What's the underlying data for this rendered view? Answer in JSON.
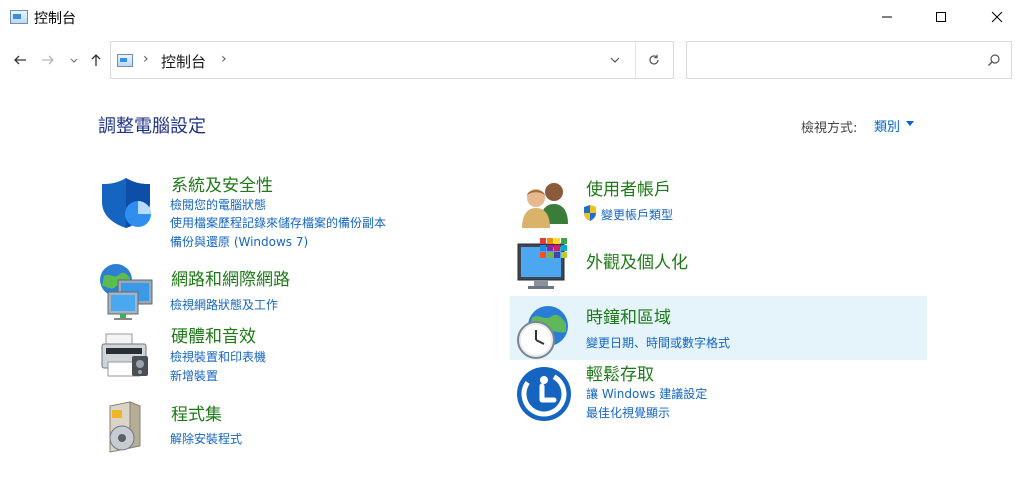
{
  "window": {
    "title": "控制台"
  },
  "address_bar": {
    "path": "控制台",
    "search_placeholder": ""
  },
  "page": {
    "title": "調整電腦設定",
    "view_by_label": "檢視方式:",
    "view_by_value": "類別"
  },
  "categories": {
    "system_security": {
      "title": "系統及安全性",
      "links": [
        "檢閱您的電腦狀態",
        "使用檔案歷程記錄來儲存檔案的備份副本",
        "備份與還原 (Windows 7)"
      ]
    },
    "network": {
      "title": "網路和網際網路",
      "links": [
        "檢視網路狀態及工作"
      ]
    },
    "hardware": {
      "title": "硬體和音效",
      "links": [
        "檢視裝置和印表機",
        "新增裝置"
      ]
    },
    "programs": {
      "title": "程式集",
      "links": [
        "解除安裝程式"
      ]
    },
    "user_accounts": {
      "title": "使用者帳戶",
      "links": [
        "變更帳戶類型"
      ]
    },
    "appearance": {
      "title": "外觀及個人化",
      "links": []
    },
    "clock_region": {
      "title": "時鐘和區域",
      "links": [
        "變更日期、時間或數字格式"
      ]
    },
    "ease_of_access": {
      "title": "輕鬆存取",
      "links": [
        "讓 Windows 建議設定",
        "最佳化視覺顯示"
      ]
    }
  },
  "colors": {
    "category_title": "#1d7a16",
    "link": "#1565c0",
    "page_title": "#1e3287",
    "hover_highlight": "#e5f3fb"
  }
}
